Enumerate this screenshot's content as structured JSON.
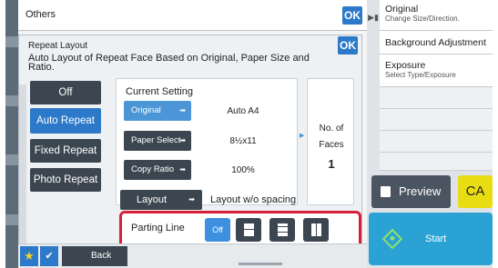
{
  "others_window": {
    "title": "Others",
    "ok_label": "OK"
  },
  "right_panel": {
    "items": [
      {
        "title": "Original",
        "subtitle": "Change Size/Direction."
      },
      {
        "title": "Background Adjustment",
        "subtitle": ""
      },
      {
        "title": "Exposure",
        "subtitle": "Select Type/Exposure"
      }
    ],
    "preview_label": "Preview",
    "ca_label": "CA",
    "start_label": "Start"
  },
  "dialog": {
    "title": "Repeat Layout",
    "description": "Auto Layout of Repeat Face Based on Original, Paper Size and Ratio.",
    "ok_label": "OK",
    "side_options": [
      {
        "label": "Off"
      },
      {
        "label": "Auto Repeat"
      },
      {
        "label": "Fixed Repeat"
      },
      {
        "label": "Photo Repeat"
      }
    ],
    "current_setting": {
      "label": "Current Setting",
      "rows": [
        {
          "button": "Original",
          "value": "Auto A4"
        },
        {
          "button": "Paper Select",
          "value": "8½x11"
        },
        {
          "button": "Copy Ratio",
          "value": "100%"
        }
      ]
    },
    "faces": {
      "label_line1": "No. of",
      "label_line2": "Faces",
      "value": "1"
    },
    "layout": {
      "button": "Layout",
      "value": "Layout w/o spacing"
    },
    "parting_line": {
      "label": "Parting Line",
      "off_label": "Off"
    }
  },
  "bottom_bar": {
    "back_label": "Back"
  },
  "colors": {
    "accent": "#2c79c9",
    "highlight": "#d81f3a",
    "dark": "#3c4651",
    "start": "#2aa3d4",
    "ca": "#e8dd13"
  }
}
